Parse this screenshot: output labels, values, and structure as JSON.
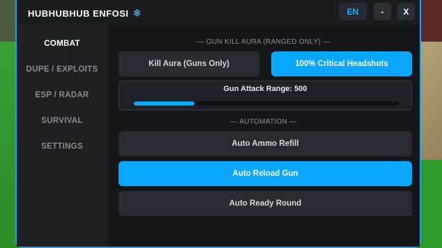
{
  "window": {
    "title": "HUBHUBHUB ENFOSI",
    "title_icon": "snowflake-icon",
    "language_label": "EN",
    "minimize_label": "-",
    "close_label": "X"
  },
  "sidebar": {
    "items": [
      {
        "label": "COMBAT",
        "active": true
      },
      {
        "label": "DUPE / EXPLOITS",
        "active": false
      },
      {
        "label": "ESP / RADAR",
        "active": false
      },
      {
        "label": "SURVIVAL",
        "active": false
      },
      {
        "label": "SETTINGS",
        "active": false
      }
    ]
  },
  "main": {
    "section_gun": "— GUN KILL AURA (RANGED ONLY) —",
    "kill_aura_label": "Kill Aura (Guns Only)",
    "kill_aura_on": false,
    "headshots_label": "100% Critical Headshots",
    "headshots_on": true,
    "range_label": "Gun Attack Range: 500",
    "range_fill_fraction": 0.23,
    "section_automation": "— AUTOMATION —",
    "ammo_label": "Auto Ammo Refill",
    "ammo_on": false,
    "reload_label": "Auto Reload Gun",
    "reload_on": true,
    "ready_label": "Auto Ready Round",
    "ready_on": false
  },
  "colors": {
    "accent": "#0aa6ff",
    "panel": "#16171a",
    "sidebar": "#1f2024"
  }
}
